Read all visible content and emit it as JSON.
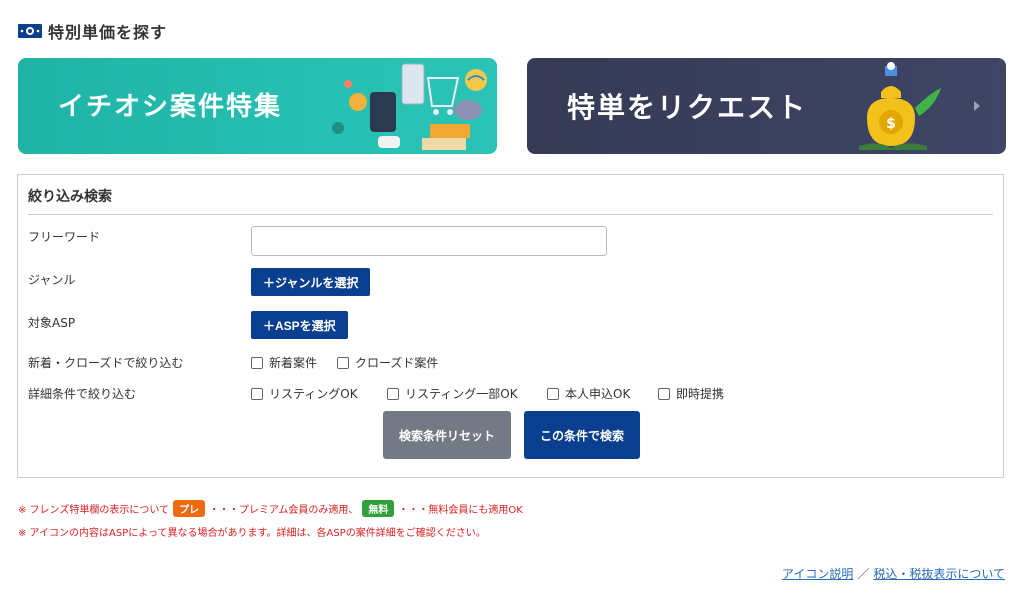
{
  "section": {
    "icon": "money-bill-icon",
    "title": "特別単価を探す"
  },
  "banners": {
    "featured": {
      "text": "イチオシ案件特集",
      "bg": "#22b8aa"
    },
    "request": {
      "text": "特単をリクエスト",
      "bg": "#3a405e"
    }
  },
  "search": {
    "heading": "絞り込み検索",
    "freeword_label": "フリーワード",
    "freeword_value": "",
    "freeword_placeholder": "",
    "genre_label": "ジャンル",
    "genre_button": "＋ジャンルを選択",
    "asp_label": "対象ASP",
    "asp_button": "＋ASPを選択",
    "new_closed_label": "新着・クローズドで絞り込む",
    "new_closed_options": [
      "新着案件",
      "クローズド案件"
    ],
    "detail_label": "詳細条件で絞り込む",
    "detail_options": [
      "リスティングOK",
      "リスティング一部OK",
      "本人申込OK",
      "即時提携"
    ],
    "reset_button": "検索条件リセット",
    "search_button": "この条件で検索",
    "primary_color": "#0a3f8f"
  },
  "notes": {
    "line1_prefix": "※ フレンズ特単欄の表示について",
    "badge_premium": "プレ",
    "line1_middle": "・・・プレミアム会員のみ適用、",
    "badge_free": "無料",
    "line1_suffix": "・・・無料会員にも適用OK",
    "line2": "※ アイコンの内容はASPによって異なる場合があります。詳細は、各ASPの案件詳細をご確認ください。"
  },
  "footer": {
    "icon_help_link": "アイコン説明",
    "separator": "／",
    "tax_link": "税込・税抜表示について"
  }
}
